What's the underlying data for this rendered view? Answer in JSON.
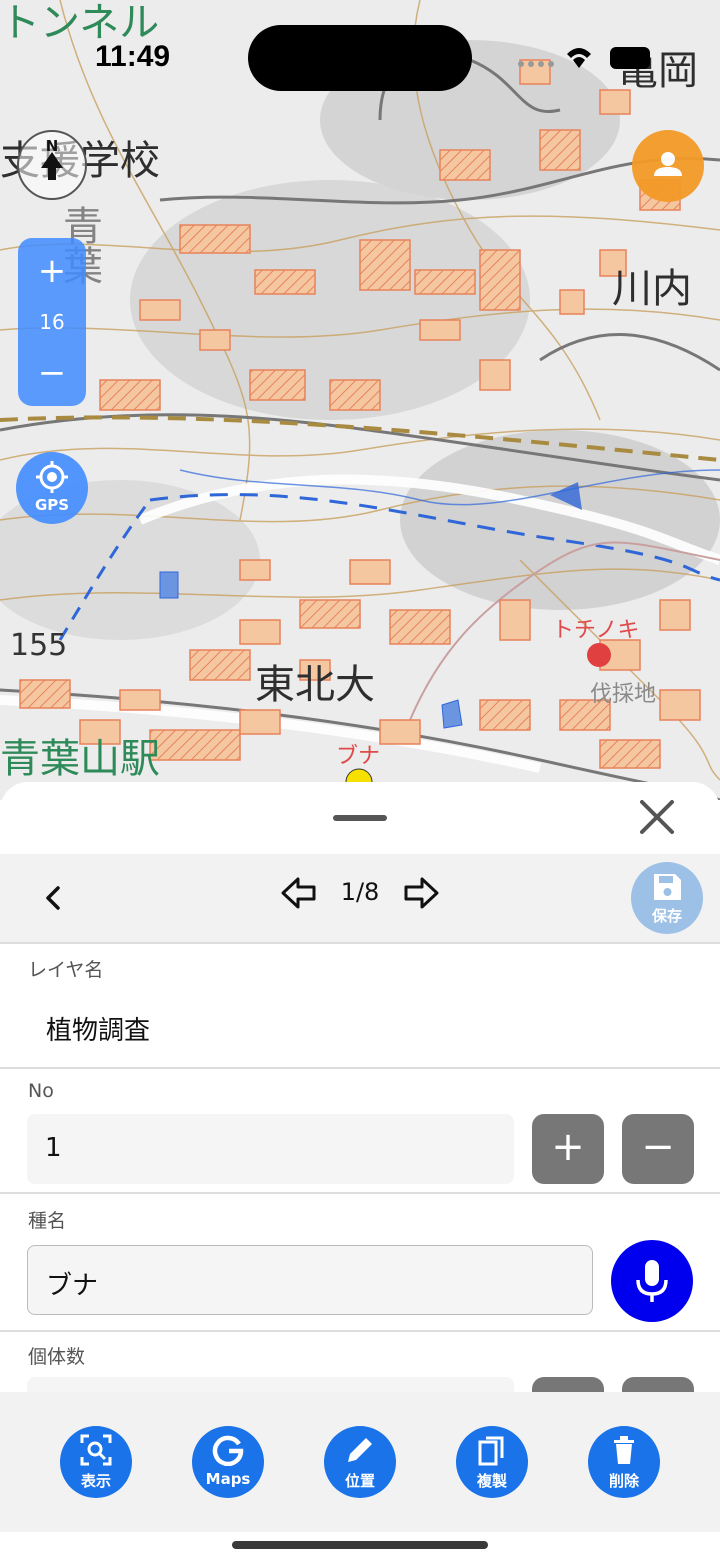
{
  "status_bar": {
    "time": "11:49"
  },
  "map": {
    "labels": {
      "tunnel": "トンネル",
      "school": "支援学校",
      "kameoka": "亀岡",
      "kawauchi": "川内",
      "aoba_vertical": "青葉",
      "elevation": "155",
      "tohoku_univ": "東北大",
      "station": "青葉山駅",
      "marker_tochinoki": "トチノキ",
      "marker_buna": "ブナ",
      "felling_site": "伐採地"
    },
    "compass_letter": "N",
    "zoom": {
      "plus": "+",
      "level": "16",
      "minus": "−"
    },
    "gps_label": "GPS",
    "markers": [
      {
        "name": "トチノキ",
        "color": "#e04040"
      },
      {
        "name": "ブナ",
        "color": "#f5e000"
      }
    ],
    "colors": {
      "building": "#f0a070",
      "contour": "#c9a060",
      "water": "#2f66d8",
      "road": "#ffffff"
    }
  },
  "sheet": {
    "pager": {
      "current": "1/8"
    },
    "save_label": "保存",
    "fields": {
      "layer_name_label": "レイヤ名",
      "layer_name_value": "植物調査",
      "no_label": "No",
      "no_value": "1",
      "increment": "+",
      "decrement": "−",
      "species_label": "種名",
      "species_value": "ブナ",
      "count_label": "個体数"
    },
    "toolbar": [
      {
        "label": "表示",
        "icon": "zoom-search-icon"
      },
      {
        "label": "Maps",
        "icon": "google-g-icon"
      },
      {
        "label": "位置",
        "icon": "pencil-icon"
      },
      {
        "label": "複製",
        "icon": "copy-icon"
      },
      {
        "label": "削除",
        "icon": "trash-icon"
      }
    ],
    "accent_color": "#1a73e8",
    "mic_color": "#0000ee"
  }
}
